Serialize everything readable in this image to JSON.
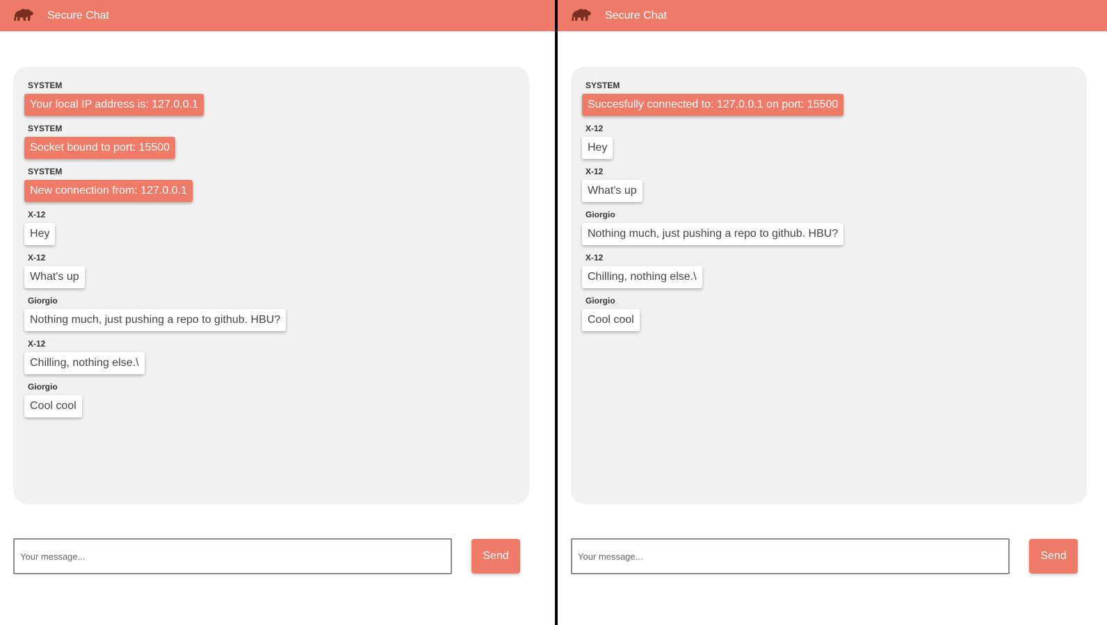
{
  "colors": {
    "accent": "#f07a68",
    "panel": "#f1f1f1"
  },
  "icons": {
    "logo": "bear-icon"
  },
  "windows": [
    {
      "header": {
        "title": "Secure Chat"
      },
      "messages": [
        {
          "sender": "SYSTEM",
          "text": "Your local IP address is: 127.0.0.1",
          "kind": "system"
        },
        {
          "sender": "SYSTEM",
          "text": "Socket bound to port: 15500",
          "kind": "system"
        },
        {
          "sender": "SYSTEM",
          "text": "New connection from: 127.0.0.1",
          "kind": "system"
        },
        {
          "sender": "X-12",
          "text": "Hey",
          "kind": "user"
        },
        {
          "sender": "X-12",
          "text": "What's up",
          "kind": "user"
        },
        {
          "sender": "Giorgio",
          "text": "Nothing much, just pushing a repo to github. HBU?",
          "kind": "user"
        },
        {
          "sender": "X-12",
          "text": "Chilling, nothing else.\\",
          "kind": "user"
        },
        {
          "sender": "Giorgio",
          "text": "Cool cool",
          "kind": "user"
        }
      ],
      "input": {
        "placeholder": "Your message...",
        "value": ""
      },
      "send_label": "Send"
    },
    {
      "header": {
        "title": "Secure Chat"
      },
      "messages": [
        {
          "sender": "SYSTEM",
          "text": "Succesfully connected to: 127.0.0.1 on port: 15500",
          "kind": "system"
        },
        {
          "sender": "X-12",
          "text": "Hey",
          "kind": "user"
        },
        {
          "sender": "X-12",
          "text": "What's up",
          "kind": "user"
        },
        {
          "sender": "Giorgio",
          "text": "Nothing much, just pushing a repo to github. HBU?",
          "kind": "user"
        },
        {
          "sender": "X-12",
          "text": "Chilling, nothing else.\\",
          "kind": "user"
        },
        {
          "sender": "Giorgio",
          "text": "Cool cool",
          "kind": "user"
        }
      ],
      "input": {
        "placeholder": "Your message...",
        "value": ""
      },
      "send_label": "Send"
    }
  ]
}
